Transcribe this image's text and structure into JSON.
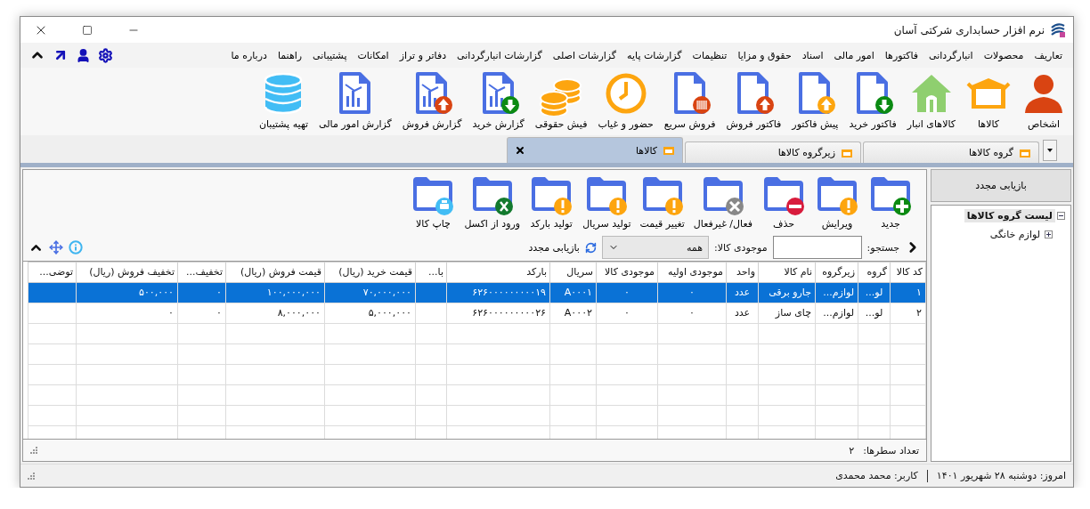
{
  "window": {
    "title": "نرم افزار حسابداری شرکتی آسان"
  },
  "menu": [
    "تعاریف",
    "محصولات",
    "انبارگردانی",
    "فاکتورها",
    "امور مالی",
    "اسناد",
    "حقوق و مزایا",
    "تنظیمات",
    "گزارشات پایه",
    "گزارشات اصلی",
    "گزارشات انبارگردانی",
    "دفاتر و تراز",
    "امکانات",
    "پشتیبانی",
    "راهنما",
    "درباره ما"
  ],
  "ribbon": [
    "اشخاص",
    "کالاها",
    "کالاهای انبار",
    "فاکتور خرید",
    "پیش فاکتور",
    "فاکتور فروش",
    "فروش سریع",
    "حضور و غیاب",
    "فیش حقوقی",
    "گزارش خرید",
    "گزارش فروش",
    "گزارش امور مالی",
    "تهیه پشتیبان"
  ],
  "tabs": [
    {
      "label": "گروه کالاها",
      "selected": false
    },
    {
      "label": "زیرگروه کالاها",
      "selected": false
    },
    {
      "label": "کالاها",
      "selected": true
    }
  ],
  "sidebar": {
    "refresh_button": "بازیابی مجدد",
    "tree": [
      {
        "label": "لیست گروه کالاها",
        "expanded": true,
        "selected": true,
        "children": [
          {
            "label": "لوازم خانگی",
            "expanded": false,
            "selected": false
          }
        ]
      }
    ]
  },
  "actions": [
    "جدید",
    "ویرایش",
    "حذف",
    "فعال/ غیرفعال",
    "تغییر قیمت",
    "تولید سریال",
    "تولید بارکد",
    "ورود از اکسل",
    "چاپ کالا"
  ],
  "filter": {
    "search_label": "جستجو:",
    "stock_label": "موجودی کالا:",
    "stock_value": "همه",
    "refresh_label": "بازیابی مجدد"
  },
  "table": {
    "columns": [
      "کد کالا",
      "گروه",
      "زیرگروه",
      "نام کالا",
      "واحد",
      "موجودی اولیه",
      "موجودی کالا",
      "سریال",
      "بارکد",
      "با...",
      "قیمت خرید (ریال)",
      "قیمت فروش (ریال)",
      "تخفیف...",
      "تخفیف فروش (ریال)",
      "توضی..."
    ],
    "rows": [
      {
        "selected": true,
        "cells": [
          "۱",
          "لو...",
          "لوازم...",
          "جارو برقی",
          "عدد",
          "۰",
          "۰",
          "A۰۰۰۱",
          "۶۲۶۰۰۰۰۰۰۰۰۰۱۹",
          null,
          "۷۰,۰۰۰,۰۰۰",
          "۱۰۰,۰۰۰,۰۰۰",
          "۰",
          "۵۰۰,۰۰۰",
          null
        ]
      },
      {
        "selected": false,
        "cells": [
          "۲",
          "لو...",
          "لوازم...",
          "چای ساز",
          "عدد",
          "۰",
          "۰",
          "A۰۰۰۲",
          "۶۲۶۰۰۰۰۰۰۰۰۰۲۶",
          null,
          "۵,۰۰۰,۰۰۰",
          "۸,۰۰۰,۰۰۰",
          "۰",
          "۰",
          null
        ]
      }
    ]
  },
  "row_count": {
    "label": "تعداد سطرها:",
    "value": "۲"
  },
  "status_bar": {
    "date": "امروز: دوشنبه ۲۸ شهریور ۱۴۰۱",
    "user": "کاربر: محمد محمدی"
  }
}
